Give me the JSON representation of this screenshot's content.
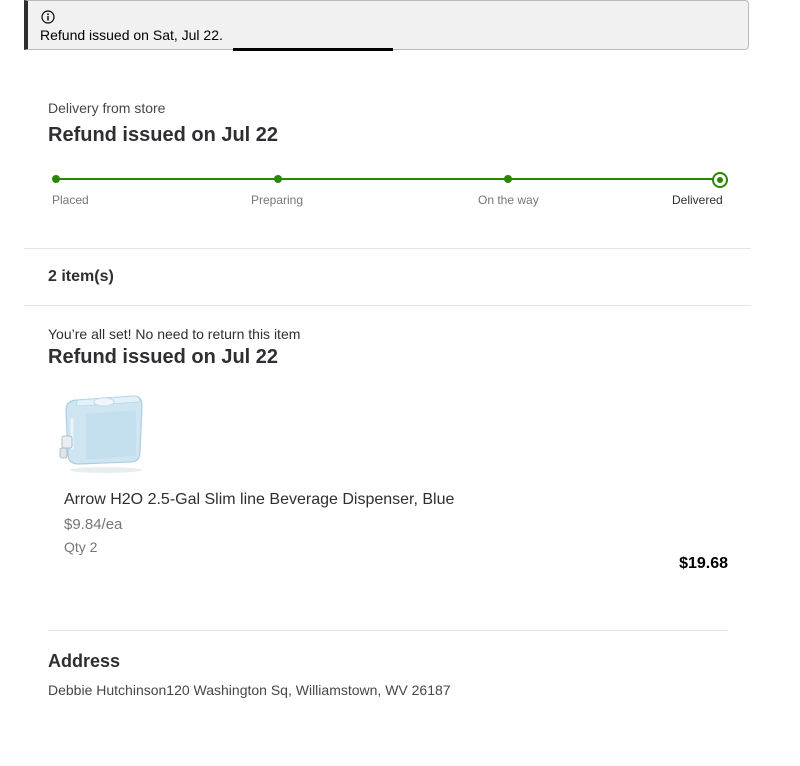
{
  "alert": {
    "icon": "info-icon",
    "message": "Refund issued on Sat, Jul 22."
  },
  "delivery": {
    "eyebrow": "Delivery from store",
    "status_heading": "Refund issued on Jul 22",
    "tracker": {
      "steps": [
        "Placed",
        "Preparing",
        "On the way",
        "Delivered"
      ],
      "current_step": "Delivered",
      "accent_color": "#2a8703"
    }
  },
  "items": {
    "count_label": "2 item(s)"
  },
  "item_group": {
    "note": "You’re all set! No need to return this item",
    "status_heading": "Refund issued on Jul 22",
    "products": [
      {
        "name": "Arrow H2O 2.5-Gal Slim line Beverage Dispenser, Blue",
        "unit_price": "$9.84/ea",
        "quantity": "Qty 2",
        "total": "$19.68"
      }
    ]
  },
  "address": {
    "title": "Address",
    "line": "Debbie Hutchinson120 Washington Sq, Williamstown, WV 26187"
  }
}
